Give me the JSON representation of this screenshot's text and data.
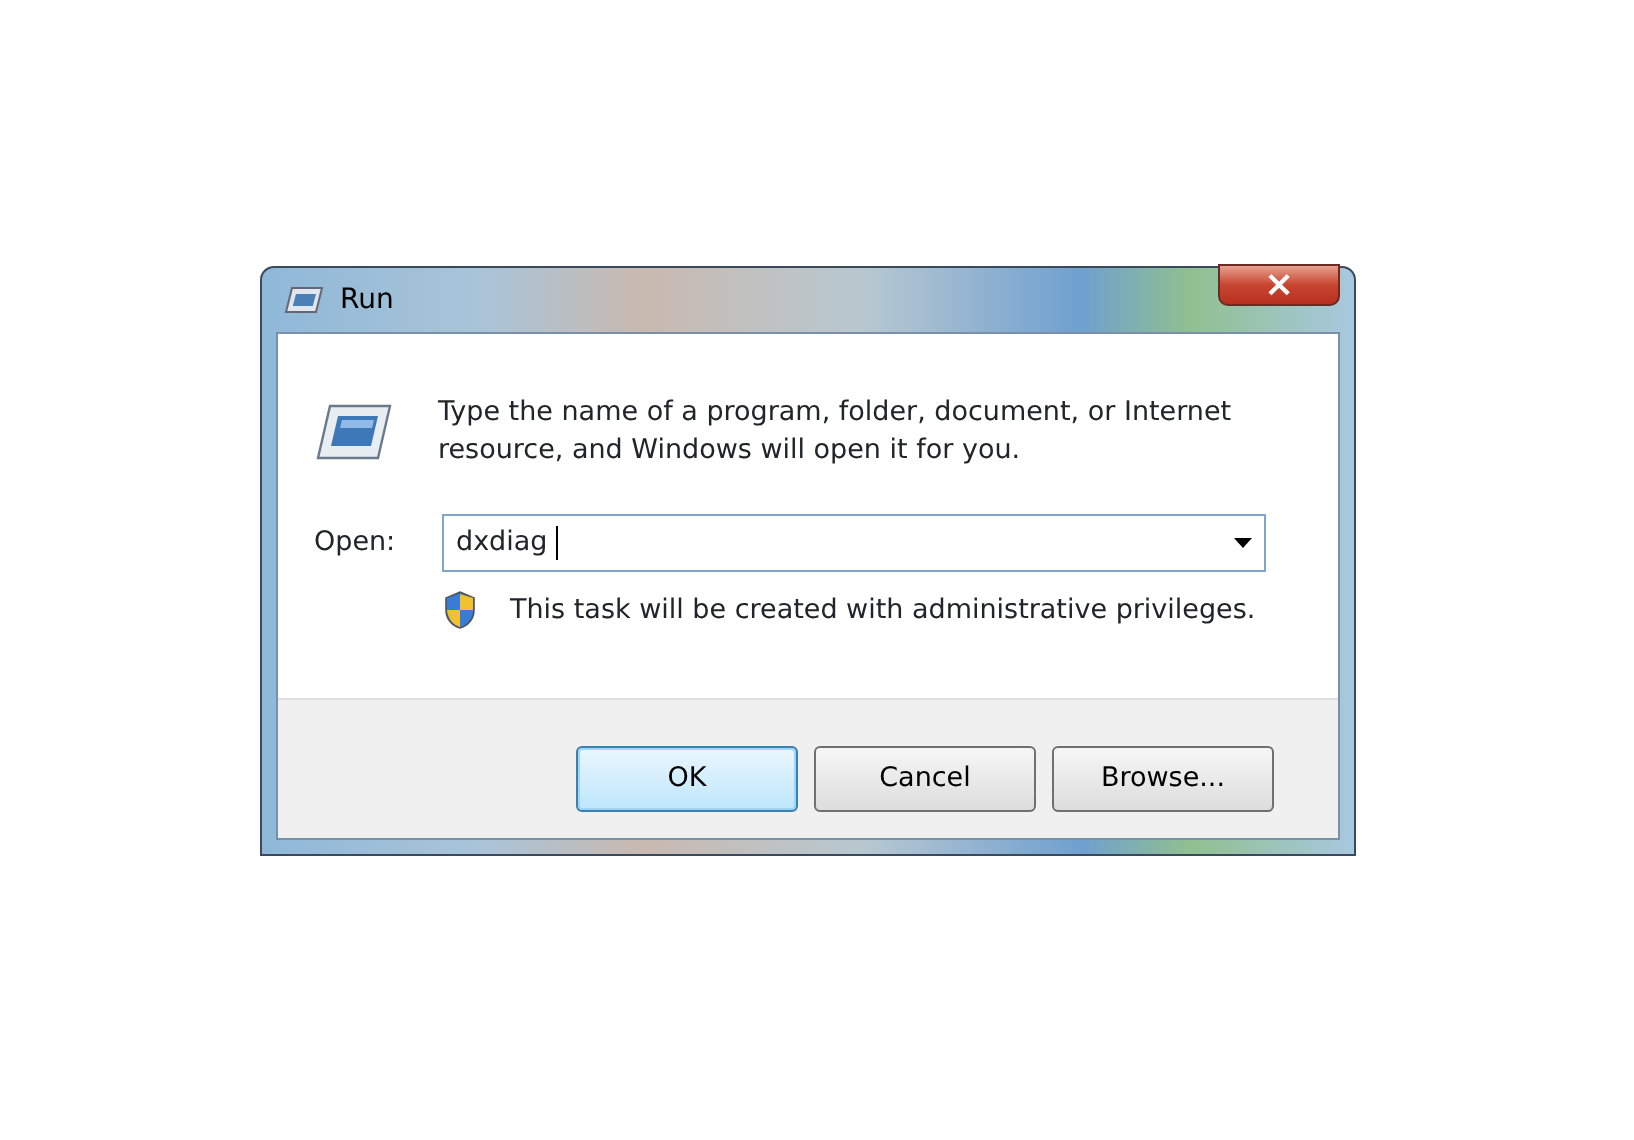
{
  "window": {
    "title": "Run",
    "close": "×"
  },
  "message": "Type the name of a program, folder, document, or Internet resource, and Windows will open it for you.",
  "open_field": {
    "label": "Open:",
    "value": "dxdiag"
  },
  "note": "This task will be created with administrative privileges.",
  "buttons": [
    {
      "label": "OK",
      "default": true
    },
    {
      "label": "Cancel",
      "default": false
    },
    {
      "label": "Browse...",
      "default": false
    }
  ]
}
